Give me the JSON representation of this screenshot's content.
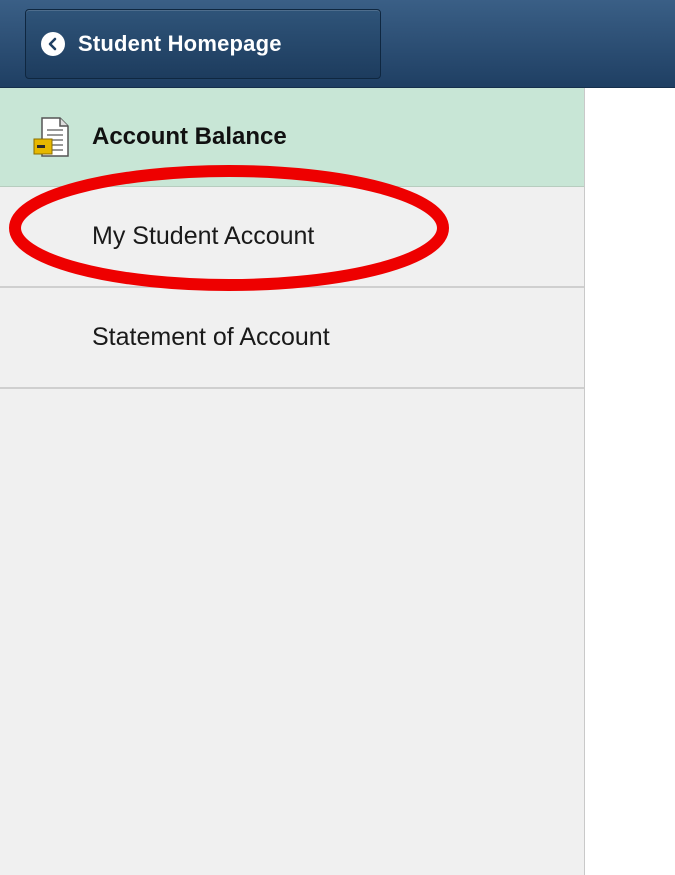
{
  "header": {
    "back_label": "Student Homepage",
    "back_icon": "chevron-left-icon"
  },
  "sidebar": {
    "section_title": "Account Balance",
    "section_icon": "account-document-icon",
    "items": [
      {
        "label": "My Student Account"
      },
      {
        "label": "Statement of Account"
      }
    ]
  },
  "annotation": {
    "highlight_color": "#ee0000",
    "highlight_target": "My Student Account"
  },
  "colors": {
    "header_bg": "#2a4d73",
    "section_bg": "#c8e6d6",
    "sidebar_bg": "#f0f0f0"
  }
}
